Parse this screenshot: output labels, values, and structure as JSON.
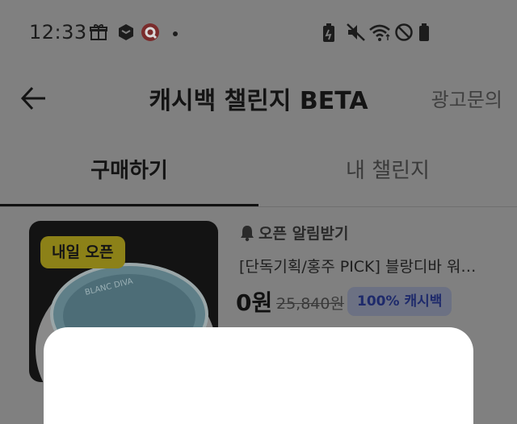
{
  "status_bar": {
    "time": "12:33",
    "left_icons": [
      "gift-icon",
      "hexagon-app-icon",
      "red-app-icon",
      "dot-icon"
    ],
    "right_icons": [
      "battery-saver-icon",
      "mute-icon",
      "wifi-icon",
      "do-not-disturb-icon",
      "battery-icon"
    ]
  },
  "header": {
    "back_icon": "arrow-left-icon",
    "title": "캐시백 챌린지 BETA",
    "ad_inquiry": "광고문의"
  },
  "tabs": [
    {
      "label": "구매하기",
      "active": true
    },
    {
      "label": "내 챌린지",
      "active": false
    }
  ],
  "product": {
    "badge": "내일 오픈",
    "alarm_label": "오픈 알림받기",
    "name": "[단독기획/홍주 PICK] 블랑디바 워…",
    "price": "0원",
    "original_price": "25,840원",
    "cashback_badge": "100% 캐시백",
    "image_text": "BLANC DIVA"
  },
  "colors": {
    "overlay": "#808080",
    "text_primary": "#141414",
    "badge_yellow": "#8c8118",
    "cashback_blue": "#1e2a6b",
    "sheet": "#ffffff"
  }
}
